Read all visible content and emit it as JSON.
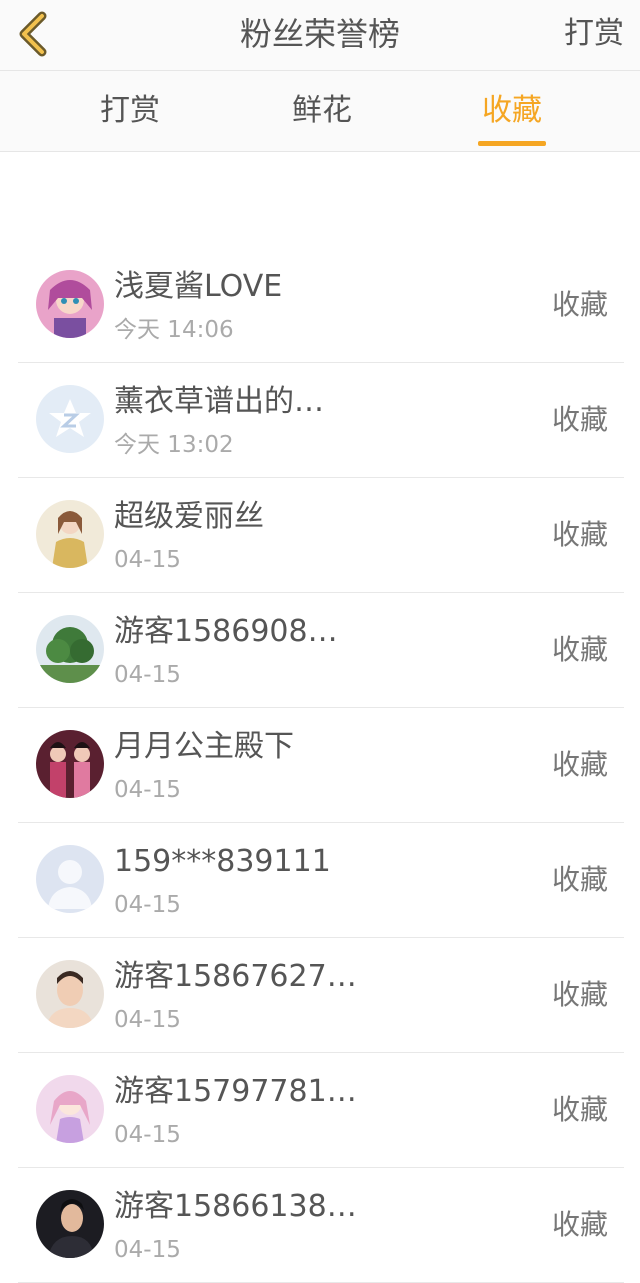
{
  "nav": {
    "title": "粉丝荣誉榜",
    "action": "打赏"
  },
  "tabs": [
    {
      "label": "打赏",
      "active": false
    },
    {
      "label": "鲜花",
      "active": false
    },
    {
      "label": "收藏",
      "active": true
    }
  ],
  "accent_color": "#f5a623",
  "fans": [
    {
      "name": "浅夏酱LOVE",
      "time": "今天 14:06",
      "action": "收藏",
      "avatar": "anime-girl-pink"
    },
    {
      "name": "薰衣草谱出的…",
      "time": "今天 13:02",
      "action": "收藏",
      "avatar": "default-qzone-icon"
    },
    {
      "name": "超级爱丽丝",
      "time": "04-15",
      "action": "收藏",
      "avatar": "woman-photo"
    },
    {
      "name": "游客1586908…",
      "time": "04-15",
      "action": "收藏",
      "avatar": "tree-photo"
    },
    {
      "name": "月月公主殿下",
      "time": "04-15",
      "action": "收藏",
      "avatar": "costume-figures"
    },
    {
      "name": "159***839111",
      "time": "04-15",
      "action": "收藏",
      "avatar": "default-person-icon"
    },
    {
      "name": "游客15867627…",
      "time": "04-15",
      "action": "收藏",
      "avatar": "face-photo"
    },
    {
      "name": "游客15797781…",
      "time": "04-15",
      "action": "收藏",
      "avatar": "anime-girl-light"
    },
    {
      "name": "游客15866138…",
      "time": "04-15",
      "action": "收藏",
      "avatar": "man-dark-photo"
    }
  ]
}
